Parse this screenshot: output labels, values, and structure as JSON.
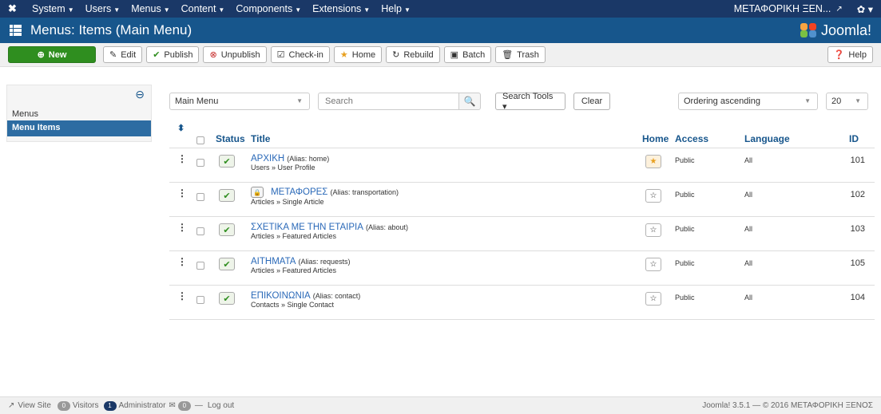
{
  "topbar": {
    "logo": "✖",
    "menu": [
      {
        "label": "System",
        "caret": "▼"
      },
      {
        "label": "Users",
        "caret": "▼"
      },
      {
        "label": "Menus",
        "caret": "▼"
      },
      {
        "label": "Content",
        "caret": "▼"
      },
      {
        "label": "Components",
        "caret": "▼"
      },
      {
        "label": "Extensions",
        "caret": "▼"
      },
      {
        "label": "Help",
        "caret": "▼"
      }
    ],
    "site_name": "ΜΕΤΑΦΟΡΙΚΗ ΞΕΝ...",
    "ext_icon": "↗",
    "gear_label": "✿ ▾"
  },
  "header": {
    "title": "Menus: Items (Main Menu)",
    "brand": "Joomla!"
  },
  "toolbar": {
    "new": "New",
    "edit": "Edit",
    "publish": "Publish",
    "unpublish": "Unpublish",
    "checkin": "Check-in",
    "home": "Home",
    "rebuild": "Rebuild",
    "batch": "Batch",
    "trash": "Trash",
    "help": "Help"
  },
  "sidebar": {
    "toggle_icon": "⊖",
    "items": [
      {
        "label": "Menus"
      },
      {
        "label": "Menu Items",
        "active": true
      }
    ]
  },
  "filters": {
    "menu_select": "Main Menu",
    "search_placeholder": "Search",
    "search_tools": "Search Tools ▾",
    "clear": "Clear",
    "ordering": "Ordering ascending",
    "limit": "20"
  },
  "table": {
    "headers": {
      "sort": "⬍",
      "status": "Status",
      "title": "Title",
      "home": "Home",
      "access": "Access",
      "language": "Language",
      "id": "ID"
    },
    "rows": [
      {
        "title": "ΑΡΧΙΚΗ",
        "alias": "(Alias: home)",
        "type": "Users » User Profile",
        "locked": false,
        "home": true,
        "access": "Public",
        "language": "All",
        "id": "101"
      },
      {
        "title": "ΜΕΤΑΦΟΡΕΣ",
        "alias": "(Alias: transportation)",
        "type": "Articles » Single Article",
        "locked": true,
        "home": false,
        "access": "Public",
        "language": "All",
        "id": "102"
      },
      {
        "title": "ΣΧΕΤΙΚΑ ΜΕ ΤΗΝ ΕΤΑΙΡΙΑ",
        "alias": "(Alias: about)",
        "type": "Articles » Featured Articles",
        "locked": false,
        "home": false,
        "access": "Public",
        "language": "All",
        "id": "103"
      },
      {
        "title": "ΑΙΤΗΜΑΤΑ",
        "alias": "(Alias: requests)",
        "type": "Articles » Featured Articles",
        "locked": false,
        "home": false,
        "access": "Public",
        "language": "All",
        "id": "105"
      },
      {
        "title": "ΕΠΙΚΟΙΝΩΝΙΑ",
        "alias": "(Alias: contact)",
        "type": "Contacts » Single Contact",
        "locked": false,
        "home": false,
        "access": "Public",
        "language": "All",
        "id": "104"
      }
    ]
  },
  "footer": {
    "view_site": "View Site",
    "visitors_count": "0",
    "visitors": "Visitors",
    "admin_count": "1",
    "admin": "Administrator",
    "messages_count": "0",
    "logout": "Log out",
    "copyright": "Joomla! 3.5.1 — © 2016 ΜΕΤΑΦΟΡΙΚΗ ΞΕΝΟΣ"
  }
}
